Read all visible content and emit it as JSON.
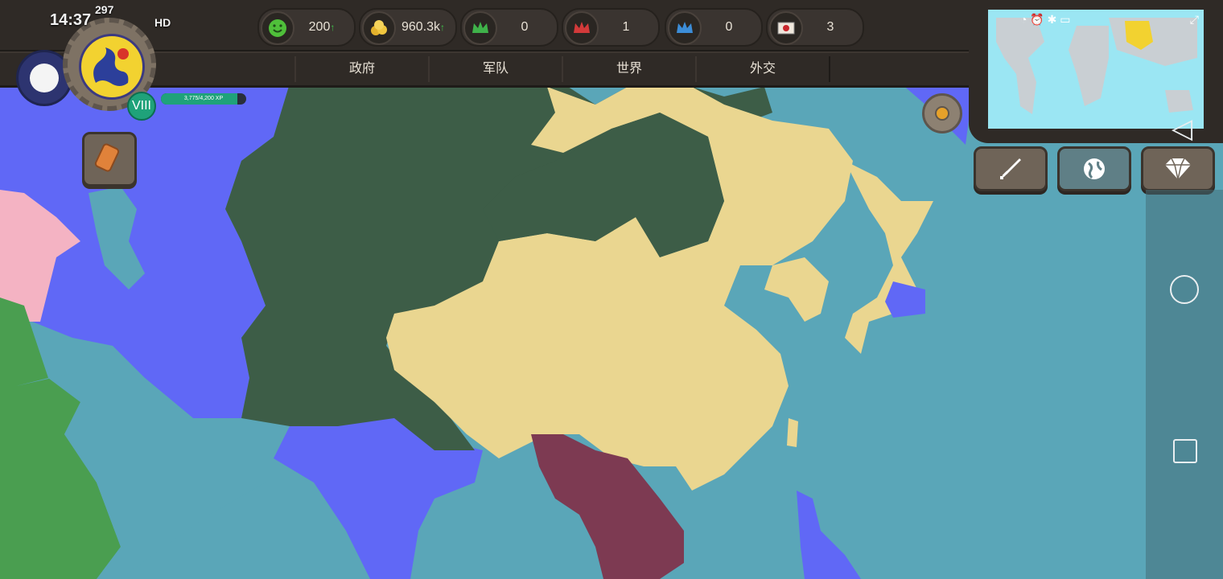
{
  "status_bar": {
    "time": "14:37",
    "signal_badge": "297",
    "network": "HD"
  },
  "resources": [
    {
      "name": "happiness",
      "icon": "smiley-icon",
      "value": "200",
      "arrow": "↑"
    },
    {
      "name": "gold",
      "icon": "coins-icon",
      "value": "960.3k",
      "arrow": "↑"
    },
    {
      "name": "green-crown",
      "icon": "crown-green-icon",
      "value": "0"
    },
    {
      "name": "red-crown",
      "icon": "crown-red-icon",
      "value": "1"
    },
    {
      "name": "blue-crown",
      "icon": "crown-blue-icon",
      "value": "0"
    },
    {
      "name": "envoy",
      "icon": "envelope-icon",
      "value": "3"
    }
  ],
  "tabs": [
    "政府",
    "军队",
    "世界",
    "外交"
  ],
  "player": {
    "level": "VIII",
    "xp_text": "3,775/4,200 XP",
    "xp_progress": 0.8988
  },
  "side_buttons": [
    "sword-icon",
    "globe-icon",
    "diamond-icon"
  ],
  "colors": {
    "ocean": "#5aa6b8",
    "player_country": "#ead690",
    "mongolia_region": "#3d5d47",
    "blue_nations": "#6068f6",
    "purple_nation": "#7d3a52",
    "green_nation": "#4a9e50",
    "pink_nation": "#f4b3c3"
  }
}
